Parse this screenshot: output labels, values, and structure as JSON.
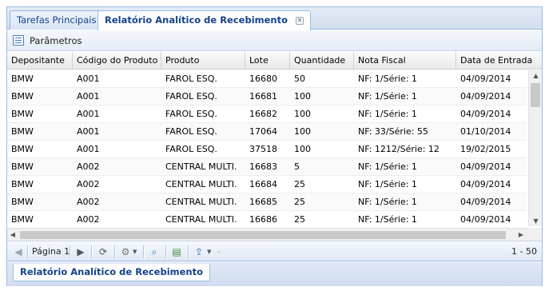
{
  "tabs": [
    {
      "label": "Tarefas Principais"
    },
    {
      "label": "Relatório Analítico de Recebimento"
    }
  ],
  "params": {
    "label": "Parâmetros"
  },
  "grid": {
    "columns": [
      "Depositante",
      "Código do Produto",
      "Produto",
      "Lote",
      "Quantidade",
      "Nota Fiscal",
      "Data de Entrada"
    ],
    "rows": [
      [
        "BMW",
        "A001",
        "FAROL ESQ.",
        "16680",
        "50",
        "NF: 1/Série: 1",
        "04/09/2014"
      ],
      [
        "BMW",
        "A001",
        "FAROL ESQ.",
        "16681",
        "100",
        "NF: 1/Série: 1",
        "04/09/2014"
      ],
      [
        "BMW",
        "A001",
        "FAROL ESQ.",
        "16682",
        "100",
        "NF: 1/Série: 1",
        "04/09/2014"
      ],
      [
        "BMW",
        "A001",
        "FAROL ESQ.",
        "17064",
        "100",
        "NF: 33/Série: 55",
        "01/10/2014"
      ],
      [
        "BMW",
        "A001",
        "FAROL ESQ.",
        "37518",
        "100",
        "NF: 1212/Série: 12",
        "19/02/2015"
      ],
      [
        "BMW",
        "A002",
        "CENTRAL MULTI.",
        "16683",
        "5",
        "NF: 1/Série: 1",
        "04/09/2014"
      ],
      [
        "BMW",
        "A002",
        "CENTRAL MULTI.",
        "16684",
        "25",
        "NF: 1/Série: 1",
        "04/09/2014"
      ],
      [
        "BMW",
        "A002",
        "CENTRAL MULTI.",
        "16685",
        "25",
        "NF: 1/Série: 1",
        "04/09/2014"
      ],
      [
        "BMW",
        "A002",
        "CENTRAL MULTI.",
        "16686",
        "25",
        "NF: 1/Série: 1",
        "04/09/2014"
      ]
    ]
  },
  "pager": {
    "page_label": "Página 1",
    "range_label": "1 - 50"
  },
  "bottom_tab": {
    "label": "Relatório Analítico de Recebimento"
  },
  "icons": {
    "params": "list-icon",
    "first": "first-page-icon",
    "next": "next-page-icon",
    "refresh": "refresh-icon",
    "settings": "gear-icon",
    "search": "search-icon",
    "chart": "chart-icon",
    "export": "export-icon"
  },
  "colors": {
    "accent": "#15428b",
    "border": "#99bbe8"
  }
}
